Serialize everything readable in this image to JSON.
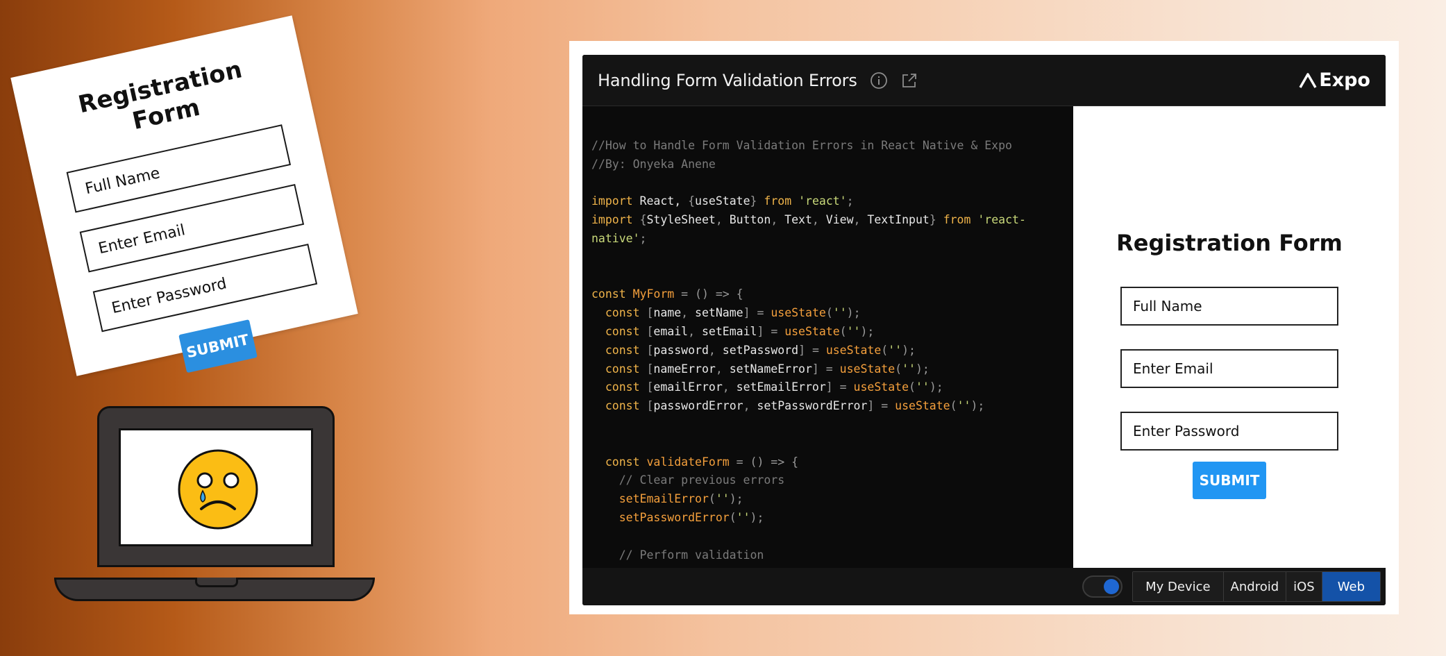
{
  "illustration": {
    "card": {
      "title": "Registration Form",
      "fields": [
        "Full Name",
        "Enter Email",
        "Enter Password"
      ],
      "submit_label": "SUBMIT"
    },
    "laptop_icon": "sad-face-icon"
  },
  "snack": {
    "title": "Handling Form Validation Errors",
    "info_icon": "info-icon",
    "external_icon": "external-link-icon",
    "brand": "Expo",
    "code_lines": [
      [
        [
          "c-cmt",
          "//How to Handle Form Validation Errors in React Native & Expo"
        ]
      ],
      [
        [
          "c-cmt",
          "//By: Onyeka Anene"
        ]
      ],
      [],
      [
        [
          "c-kw",
          "import"
        ],
        [
          "c-id",
          " React, "
        ],
        [
          "c-pun",
          "{"
        ],
        [
          "c-id",
          "useState"
        ],
        [
          "c-pun",
          "}"
        ],
        [
          "c-id",
          " "
        ],
        [
          "c-kw",
          "from"
        ],
        [
          "c-id",
          " "
        ],
        [
          "c-str",
          "'react'"
        ],
        [
          "c-pun",
          ";"
        ]
      ],
      [
        [
          "c-kw",
          "import"
        ],
        [
          "c-id",
          " "
        ],
        [
          "c-pun",
          "{"
        ],
        [
          "c-id",
          "StyleSheet"
        ],
        [
          "c-pun",
          ","
        ],
        [
          "c-id",
          " Button"
        ],
        [
          "c-pun",
          ","
        ],
        [
          "c-id",
          " Text"
        ],
        [
          "c-pun",
          ","
        ],
        [
          "c-id",
          " View"
        ],
        [
          "c-pun",
          ","
        ],
        [
          "c-id",
          " TextInput"
        ],
        [
          "c-pun",
          "}"
        ],
        [
          "c-id",
          " "
        ],
        [
          "c-kw",
          "from"
        ],
        [
          "c-id",
          " "
        ],
        [
          "c-str",
          "'react-"
        ]
      ],
      [
        [
          "c-str",
          "native'"
        ],
        [
          "c-pun",
          ";"
        ]
      ],
      [],
      [],
      [
        [
          "c-kw",
          "const"
        ],
        [
          "c-id",
          " "
        ],
        [
          "c-def",
          "MyForm"
        ],
        [
          "c-id",
          " "
        ],
        [
          "c-pun",
          "= () => {"
        ]
      ],
      [
        [
          "c-id",
          "  "
        ],
        [
          "c-kw",
          "const"
        ],
        [
          "c-id",
          " "
        ],
        [
          "c-pun",
          "["
        ],
        [
          "c-id",
          "name"
        ],
        [
          "c-pun",
          ","
        ],
        [
          "c-id",
          " setName"
        ],
        [
          "c-pun",
          "]"
        ],
        [
          "c-id",
          " "
        ],
        [
          "c-pun",
          "="
        ],
        [
          "c-id",
          " "
        ],
        [
          "c-fn",
          "useState"
        ],
        [
          "c-pun",
          "("
        ],
        [
          "c-str",
          "''"
        ],
        [
          "c-pun",
          ");"
        ]
      ],
      [
        [
          "c-id",
          "  "
        ],
        [
          "c-kw",
          "const"
        ],
        [
          "c-id",
          " "
        ],
        [
          "c-pun",
          "["
        ],
        [
          "c-id",
          "email"
        ],
        [
          "c-pun",
          ","
        ],
        [
          "c-id",
          " setEmail"
        ],
        [
          "c-pun",
          "]"
        ],
        [
          "c-id",
          " "
        ],
        [
          "c-pun",
          "="
        ],
        [
          "c-id",
          " "
        ],
        [
          "c-fn",
          "useState"
        ],
        [
          "c-pun",
          "("
        ],
        [
          "c-str",
          "''"
        ],
        [
          "c-pun",
          ");"
        ]
      ],
      [
        [
          "c-id",
          "  "
        ],
        [
          "c-kw",
          "const"
        ],
        [
          "c-id",
          " "
        ],
        [
          "c-pun",
          "["
        ],
        [
          "c-id",
          "password"
        ],
        [
          "c-pun",
          ","
        ],
        [
          "c-id",
          " setPassword"
        ],
        [
          "c-pun",
          "]"
        ],
        [
          "c-id",
          " "
        ],
        [
          "c-pun",
          "="
        ],
        [
          "c-id",
          " "
        ],
        [
          "c-fn",
          "useState"
        ],
        [
          "c-pun",
          "("
        ],
        [
          "c-str",
          "''"
        ],
        [
          "c-pun",
          ");"
        ]
      ],
      [
        [
          "c-id",
          "  "
        ],
        [
          "c-kw",
          "const"
        ],
        [
          "c-id",
          " "
        ],
        [
          "c-pun",
          "["
        ],
        [
          "c-id",
          "nameError"
        ],
        [
          "c-pun",
          ","
        ],
        [
          "c-id",
          " setNameError"
        ],
        [
          "c-pun",
          "]"
        ],
        [
          "c-id",
          " "
        ],
        [
          "c-pun",
          "="
        ],
        [
          "c-id",
          " "
        ],
        [
          "c-fn",
          "useState"
        ],
        [
          "c-pun",
          "("
        ],
        [
          "c-str",
          "''"
        ],
        [
          "c-pun",
          ");"
        ]
      ],
      [
        [
          "c-id",
          "  "
        ],
        [
          "c-kw",
          "const"
        ],
        [
          "c-id",
          " "
        ],
        [
          "c-pun",
          "["
        ],
        [
          "c-id",
          "emailError"
        ],
        [
          "c-pun",
          ","
        ],
        [
          "c-id",
          " setEmailError"
        ],
        [
          "c-pun",
          "]"
        ],
        [
          "c-id",
          " "
        ],
        [
          "c-pun",
          "="
        ],
        [
          "c-id",
          " "
        ],
        [
          "c-fn",
          "useState"
        ],
        [
          "c-pun",
          "("
        ],
        [
          "c-str",
          "''"
        ],
        [
          "c-pun",
          ");"
        ]
      ],
      [
        [
          "c-id",
          "  "
        ],
        [
          "c-kw",
          "const"
        ],
        [
          "c-id",
          " "
        ],
        [
          "c-pun",
          "["
        ],
        [
          "c-id",
          "passwordError"
        ],
        [
          "c-pun",
          ","
        ],
        [
          "c-id",
          " setPasswordError"
        ],
        [
          "c-pun",
          "]"
        ],
        [
          "c-id",
          " "
        ],
        [
          "c-pun",
          "="
        ],
        [
          "c-id",
          " "
        ],
        [
          "c-fn",
          "useState"
        ],
        [
          "c-pun",
          "("
        ],
        [
          "c-str",
          "''"
        ],
        [
          "c-pun",
          ");"
        ]
      ],
      [],
      [],
      [
        [
          "c-id",
          "  "
        ],
        [
          "c-kw",
          "const"
        ],
        [
          "c-id",
          " "
        ],
        [
          "c-def",
          "validateForm"
        ],
        [
          "c-id",
          " "
        ],
        [
          "c-pun",
          "= () => {"
        ]
      ],
      [
        [
          "c-cmt",
          "    // Clear previous errors"
        ]
      ],
      [
        [
          "c-id",
          "    "
        ],
        [
          "c-fn",
          "setEmailError"
        ],
        [
          "c-pun",
          "("
        ],
        [
          "c-str",
          "''"
        ],
        [
          "c-pun",
          ");"
        ]
      ],
      [
        [
          "c-id",
          "    "
        ],
        [
          "c-fn",
          "setPasswordError"
        ],
        [
          "c-pun",
          "("
        ],
        [
          "c-str",
          "''"
        ],
        [
          "c-pun",
          ");"
        ]
      ],
      [],
      [
        [
          "c-cmt",
          "    // Perform validation"
        ]
      ]
    ],
    "preview": {
      "title": "Registration Form",
      "name_placeholder": "Full Name",
      "email_placeholder": "Enter Email",
      "password_placeholder": "Enter Password",
      "submit_label": "SUBMIT"
    },
    "footer": {
      "toggle_on": true,
      "platforms": [
        "My Device",
        "Android",
        "iOS",
        "Web"
      ],
      "active_platform": "Web"
    }
  },
  "colors": {
    "submit_blue": "#2196f3",
    "active_platform": "#1452a8",
    "keyword": "#f0b44a",
    "string": "#c9d97a"
  }
}
